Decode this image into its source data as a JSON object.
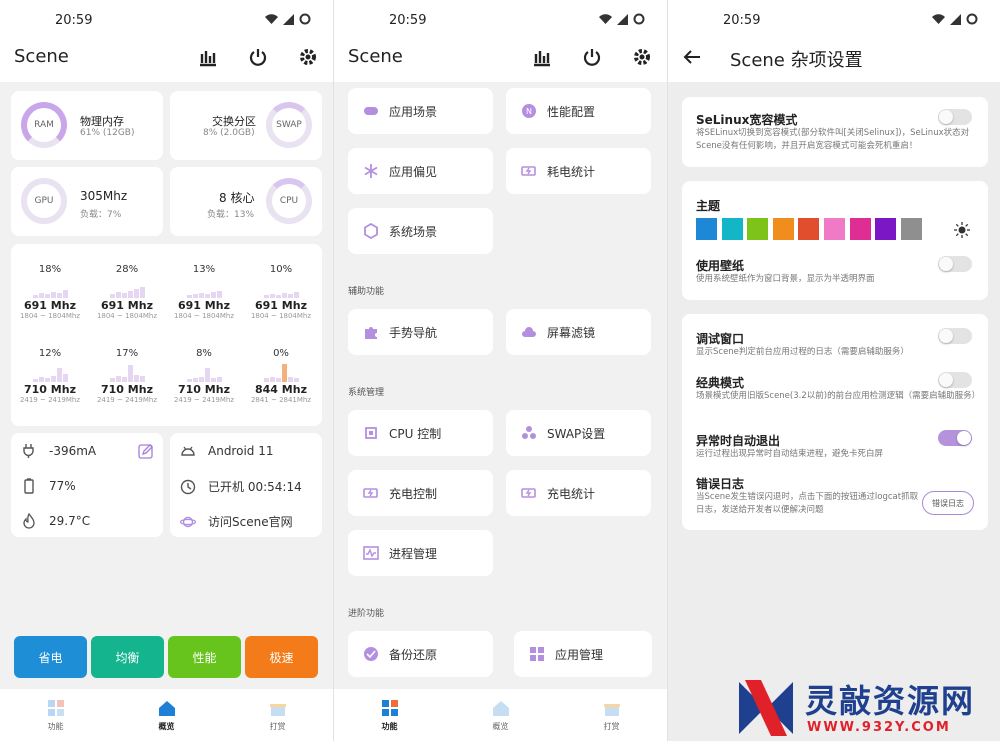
{
  "status_bar": {
    "time": "20:59"
  },
  "screen1": {
    "title": "Scene",
    "mem": {
      "ring": "RAM",
      "title": "物理内存",
      "detail": "61% (12GB)"
    },
    "swap": {
      "ring": "SWAP",
      "title": "交换分区",
      "detail": "8% (2.0GB)"
    },
    "gpu": {
      "ring": "GPU",
      "title": "305Mhz",
      "detail": "负载：7%"
    },
    "cpu": {
      "ring": "CPU",
      "title": "8 核心",
      "detail": "负载：13%"
    },
    "cores": [
      {
        "pct": "18%",
        "mhz": "691 Mhz",
        "range": "1804 ~ 1804Mhz",
        "load": 0.18
      },
      {
        "pct": "28%",
        "mhz": "691 Mhz",
        "range": "1804 ~ 1804Mhz",
        "load": 0.28
      },
      {
        "pct": "13%",
        "mhz": "691 Mhz",
        "range": "1804 ~ 1804Mhz",
        "load": 0.13
      },
      {
        "pct": "10%",
        "mhz": "691 Mhz",
        "range": "1804 ~ 1804Mhz",
        "load": 0.1
      },
      {
        "pct": "12%",
        "mhz": "710 Mhz",
        "range": "2419 ~ 2419Mhz",
        "load": 0.12
      },
      {
        "pct": "17%",
        "mhz": "710 Mhz",
        "range": "2419 ~ 2419Mhz",
        "load": 0.17
      },
      {
        "pct": "8%",
        "mhz": "710 Mhz",
        "range": "2419 ~ 2419Mhz",
        "load": 0.08
      },
      {
        "pct": "0%",
        "mhz": "844 Mhz",
        "range": "2841 ~ 2841Mhz",
        "load": 0.0
      }
    ],
    "battery": {
      "current": "-396mA",
      "level": "77%",
      "temp": "29.7°C"
    },
    "system": {
      "android": "Android 11",
      "uptime": "已开机  00:54:14",
      "website": "访问Scene官网"
    },
    "modes": [
      {
        "label": "省电",
        "color": "#1e8fd6"
      },
      {
        "label": "均衡",
        "color": "#14b58e"
      },
      {
        "label": "性能",
        "color": "#67c41c"
      },
      {
        "label": "极速",
        "color": "#f47b19"
      }
    ],
    "nav": [
      "功能",
      "概览",
      "打赏"
    ]
  },
  "screen2": {
    "title": "Scene",
    "buttons": {
      "app_scene": "应用场景",
      "perf_config": "性能配置",
      "app_pref": "应用偏见",
      "power_stats": "耗电统计",
      "sys_scene": "系统场景",
      "gesture_nav": "手势导航",
      "screen_filter": "屏幕滤镜",
      "cpu_control": "CPU 控制",
      "swap_settings": "SWAP设置",
      "charge_control": "充电控制",
      "charge_stats": "充电统计",
      "process_mgr": "进程管理",
      "backup": "备份还原",
      "app_mgr": "应用管理"
    },
    "sections": {
      "aux": "辅助功能",
      "system": "系统管理",
      "advanced": "进阶功能"
    },
    "nav": [
      "功能",
      "概览",
      "打赏"
    ]
  },
  "screen3": {
    "title": "Scene 杂项设置",
    "selinux": {
      "title": "SeLinux宽容模式",
      "desc": "将SELinux切换到宽容模式(部分软件叫[关闭Selinux])，SeLinux状态对Scene没有任何影响，并且开启宽容模式可能会死机重启！"
    },
    "theme": {
      "title": "主题",
      "colors": [
        "#1e88d6",
        "#13b6c6",
        "#7ec319",
        "#f18d1d",
        "#e04e2e",
        "#f07ac6",
        "#de2e93",
        "#7b17c4",
        "#8f8f8f"
      ]
    },
    "wallpaper": {
      "title": "使用壁纸",
      "desc": "使用系统壁纸作为窗口背景，显示为半透明界面"
    },
    "debug": {
      "title": "调试窗口",
      "desc": "显示Scene判定前台应用过程的日志（需要启辅助服务）"
    },
    "classic": {
      "title": "经典模式",
      "desc": "场景模式使用旧版Scene(3.2以前)的前台应用检测逻辑（需要启辅助服务）"
    },
    "autoexit": {
      "title": "异常时自动退出",
      "desc": "运行过程出现异常时自动结束进程，避免卡死白屏"
    },
    "errlog": {
      "title": "错误日志",
      "desc": "当Scene发生错误闪退时，点击下面的按钮通过logcat抓取日志，发送给开发者以便解决问题",
      "button": "错误日志"
    }
  },
  "watermark": {
    "cn": "灵敲资源网",
    "url": "WWW.932Y.COM"
  }
}
